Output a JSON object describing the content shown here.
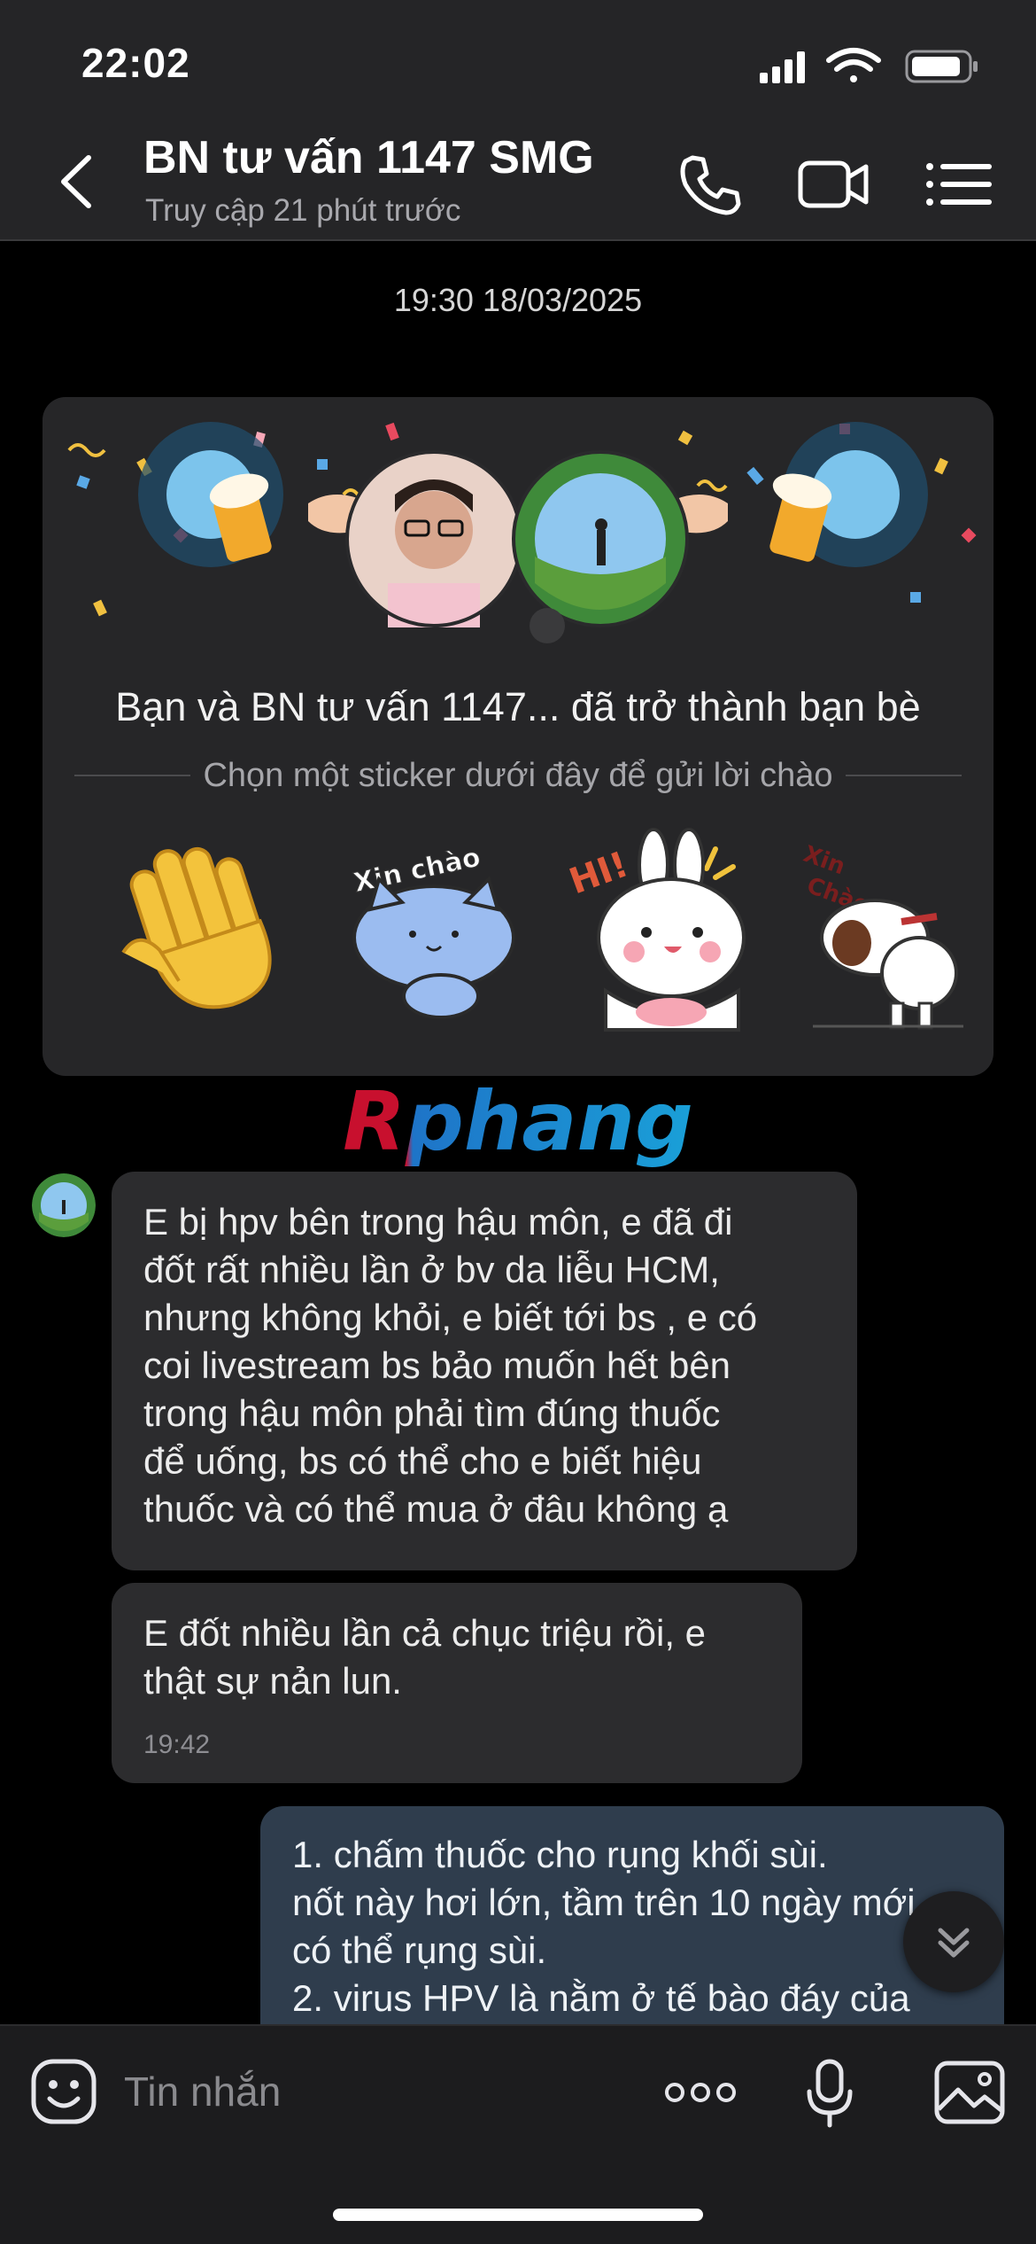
{
  "status_bar": {
    "time": "22:02",
    "icons": [
      "cellular-signal-icon",
      "wifi-icon",
      "battery-icon"
    ]
  },
  "header": {
    "title": "BN tư vấn 1147 SMG",
    "subtitle": "Truy cập 21 phút trước",
    "icons": [
      "back-chevron-icon",
      "phone-call-icon",
      "video-call-icon",
      "menu-list-icon"
    ]
  },
  "chat": {
    "date_separator": "19:30 18/03/2025",
    "welcome_card": {
      "title": "Bạn và BN tư vấn 1147...   đã trở thành bạn bè",
      "subtitle": "Chọn một sticker dưới đây để gửi lời chào",
      "stickers": [
        {
          "name": "waving-hand-sticker",
          "text": ""
        },
        {
          "name": "blue-cat-xin-chao-sticker",
          "text": "Xin chào"
        },
        {
          "name": "bunny-hi-sticker",
          "text": "HI!"
        },
        {
          "name": "dog-xin-chao-sticker",
          "text": "Xin chào"
        }
      ]
    },
    "watermark": "Rphang",
    "messages": [
      {
        "direction": "incoming",
        "lines": [
          "E bị hpv bên trong hậu môn, e đã đi",
          "đốt rất nhiều lần ở bv da liễu HCM,",
          "nhưng không khỏi, e biết tới bs , e có",
          "coi livestream bs  bảo muốn hết bên",
          "trong hậu môn phải tìm đúng thuốc",
          "để uống, bs có thể cho e biết hiệu",
          "thuốc và có thể mua ở đâu không ạ"
        ],
        "time": ""
      },
      {
        "direction": "incoming",
        "lines": [
          "E đốt nhiều lần cả chục triệu rồi, e",
          "thật sự nản lun."
        ],
        "time": "19:42"
      },
      {
        "direction": "outgoing",
        "lines": [
          "1.  chấm  thuốc  cho rụng khối  sùi.",
          "nốt này hơi lớn, tầm trên 10 ngày mới",
          "có thể rụng sùi.",
          "2. virus HPV là nằm ở tế bào đáy của"
        ],
        "time": ""
      }
    ]
  },
  "composer": {
    "placeholder": "Tin nhắn",
    "icons": [
      "sticker-smiley-icon",
      "more-options-icon",
      "microphone-icon",
      "image-gallery-icon"
    ]
  },
  "colors": {
    "background": "#000000",
    "header_bg": "#252527",
    "incoming_bubble": "#2c2c2e",
    "outgoing_bubble": "#2f3d4d",
    "card_bg": "#262628"
  }
}
